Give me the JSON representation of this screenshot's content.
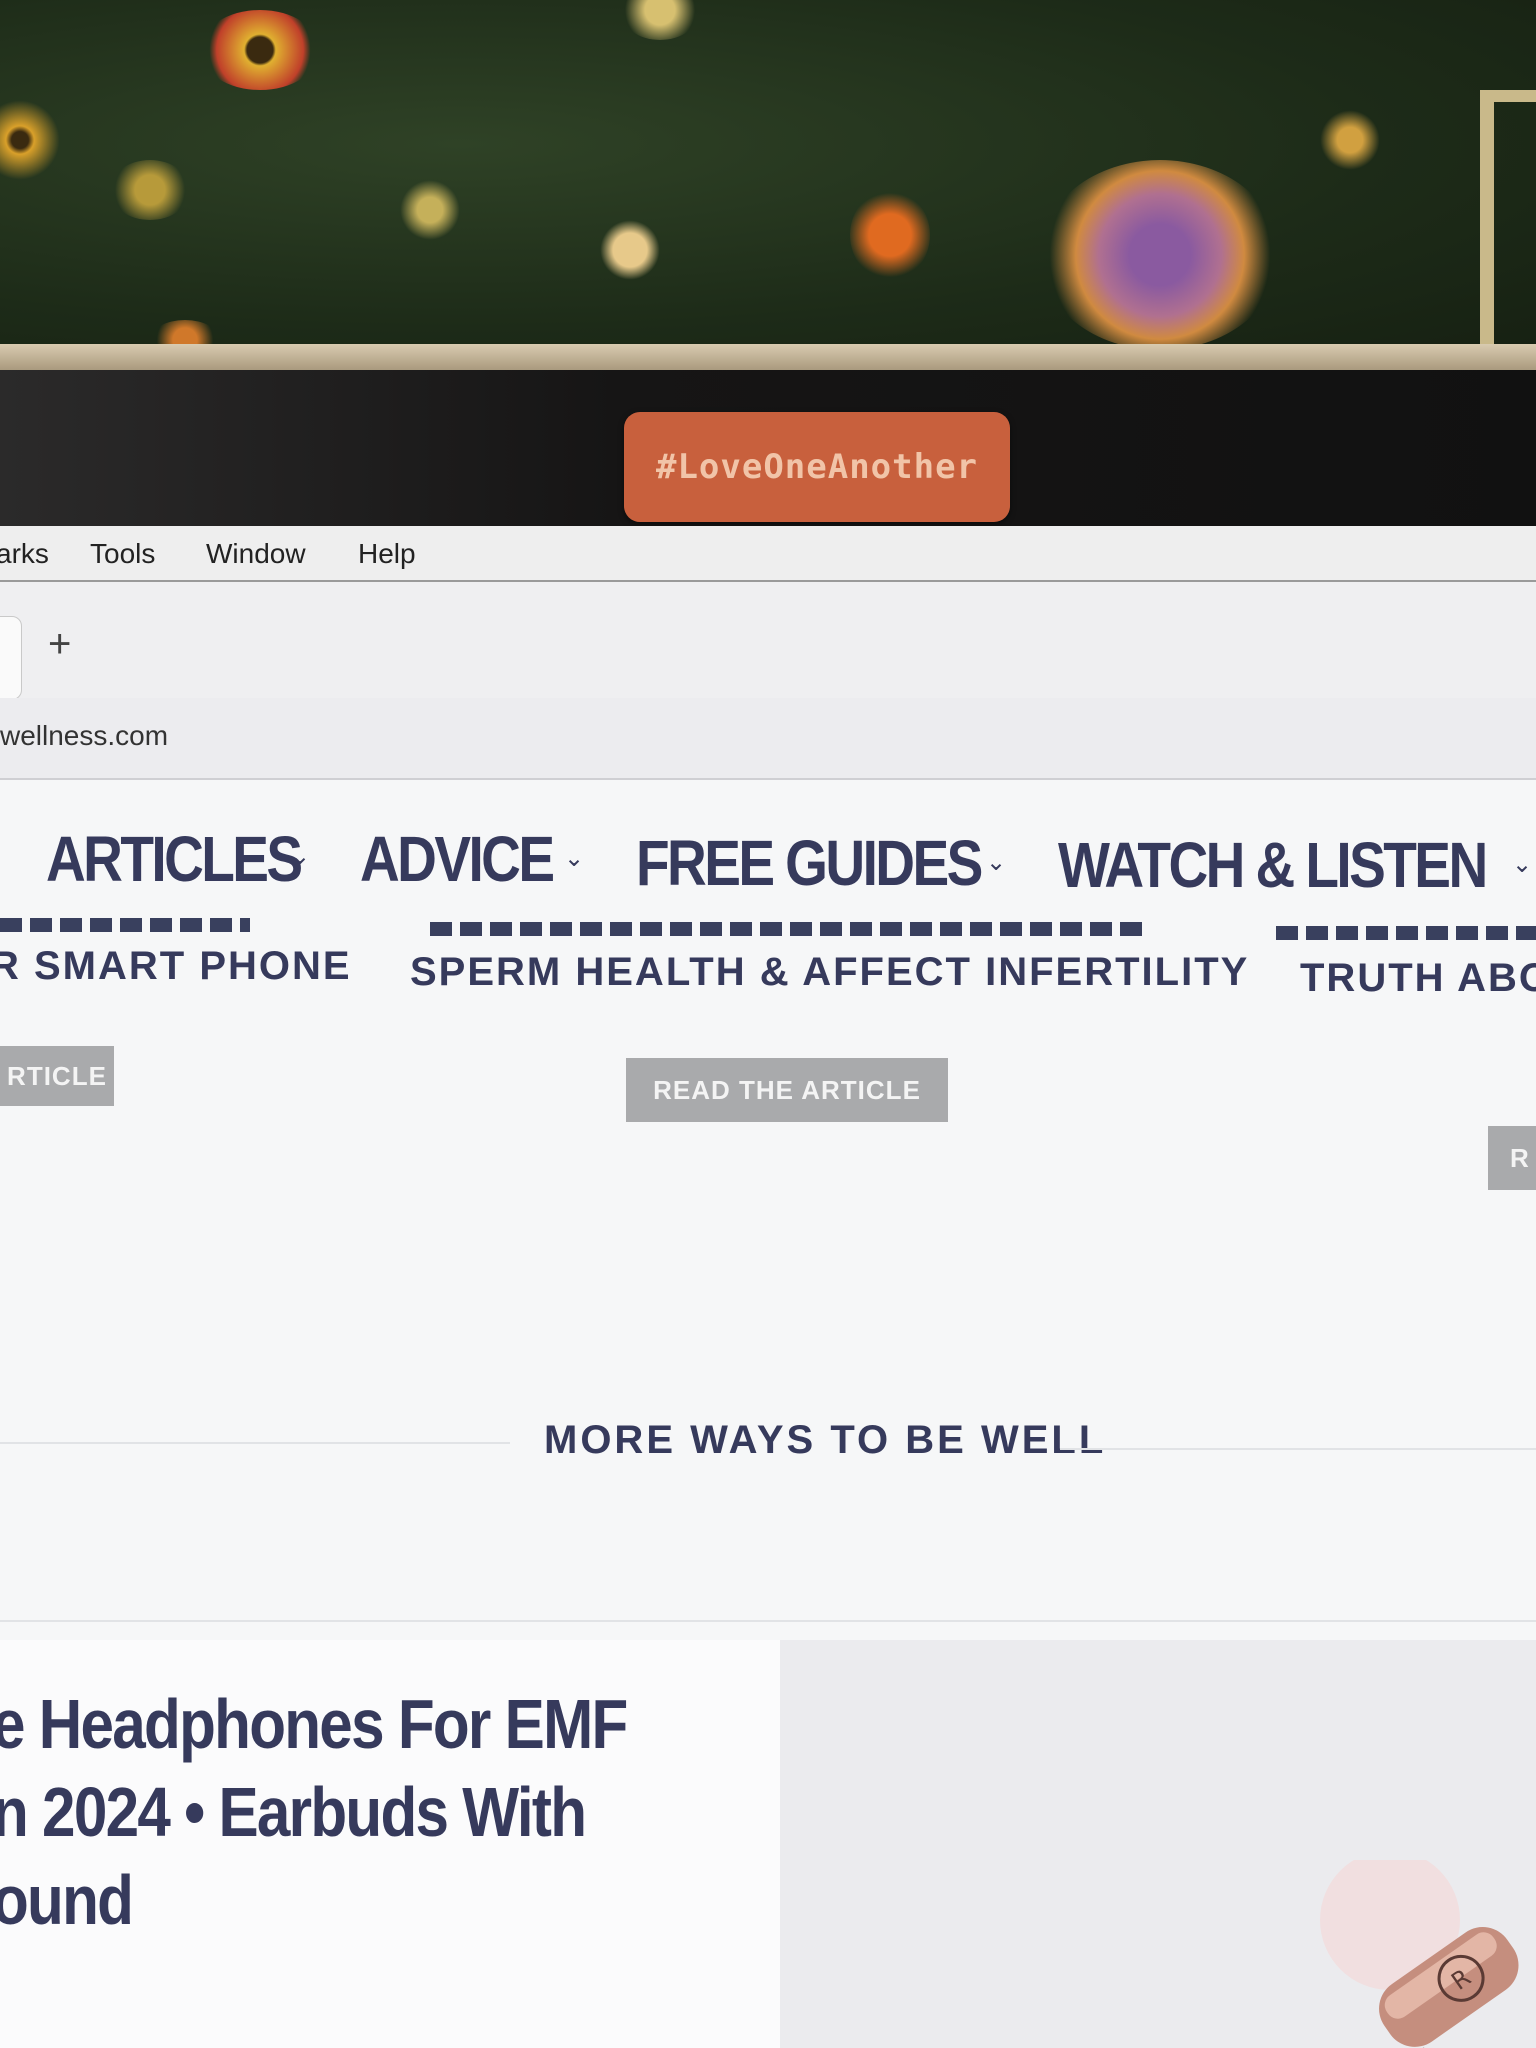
{
  "sticker": {
    "text": "#LoveOneAnother"
  },
  "menu": {
    "items": [
      "arks",
      "Tools",
      "Window",
      "Help"
    ]
  },
  "tabbar": {
    "new_tab_symbol": "+"
  },
  "address_bar": {
    "url": "wellness.com"
  },
  "site_nav": {
    "items": [
      "ARTICLES",
      "ADVICE",
      "FREE GUIDES",
      "WATCH & LISTEN"
    ],
    "chevron": "⌄"
  },
  "cards": [
    {
      "title_line2": "R SMART PHONE",
      "button": "RTICLE"
    },
    {
      "title_line2": "SPERM HEALTH & AFFECT INFERTILITY",
      "button": "READ THE ARTICLE"
    },
    {
      "title_line2": "TRUTH ABO",
      "button": "R"
    }
  ],
  "section": {
    "title": "MORE WAYS TO BE WELL"
  },
  "feature": {
    "headline_lines": [
      "e Headphones For EMF",
      "n 2024 • Earbuds With",
      "ound"
    ]
  },
  "colors": {
    "navy_text": "#363a5c",
    "sticker_orange": "#c8603d",
    "button_gray": "#a9aaac"
  }
}
